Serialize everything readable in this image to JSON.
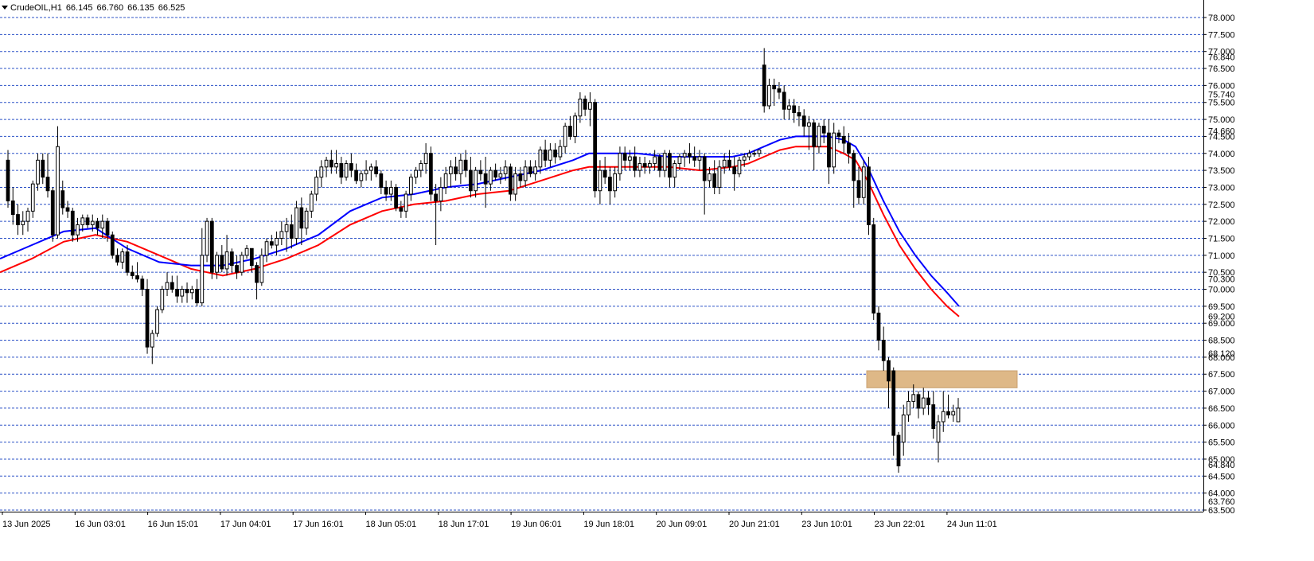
{
  "header": {
    "symbol_tf": "CrudeOIL,H1",
    "open": "66.145",
    "high": "66.760",
    "low": "66.135",
    "close": "66.525"
  },
  "colors": {
    "grid": "#2f54c7",
    "bull": "#ffffff",
    "bear": "#000000",
    "ma_fast": "#0000ff",
    "ma_slow": "#ff0000",
    "zone": "#deb887",
    "border": "#000000"
  },
  "chart_data": {
    "type": "candlestick",
    "symbol": "CrudeOIL",
    "timeframe": "H1",
    "ylim": [
      63.5,
      78.0
    ],
    "y_ticks": [
      "78.000",
      "77.500",
      "77.000",
      "76.500",
      "76.000",
      "75.500",
      "75.000",
      "74.500",
      "74.000",
      "73.500",
      "73.000",
      "72.500",
      "72.000",
      "71.500",
      "71.000",
      "70.500",
      "70.000",
      "69.500",
      "69.000",
      "68.500",
      "68.000",
      "67.500",
      "67.000",
      "66.500",
      "66.000",
      "65.500",
      "65.000",
      "64.500",
      "64.000",
      "63.500"
    ],
    "partial_labels": [
      "76.840",
      "75.740",
      "74.660",
      "70.300",
      "69.200",
      "68.120",
      "64.840",
      "63.760"
    ],
    "x_labels": [
      "13 Jun 2025",
      "16 Jun 03:01",
      "16 Jun 15:01",
      "17 Jun 04:01",
      "17 Jun 16:01",
      "18 Jun 05:01",
      "18 Jun 17:01",
      "19 Jun 06:01",
      "19 Jun 18:01",
      "20 Jun 09:01",
      "20 Jun 21:01",
      "23 Jun 10:01",
      "23 Jun 22:01",
      "24 Jun 11:01"
    ],
    "ohlc": [
      [
        73.8,
        74.1,
        72.4,
        72.6
      ],
      [
        72.6,
        73.0,
        71.9,
        72.2
      ],
      [
        72.2,
        72.5,
        71.6,
        71.9
      ],
      [
        71.9,
        72.3,
        71.6,
        72.0
      ],
      [
        72.0,
        72.4,
        71.7,
        72.3
      ],
      [
        72.3,
        73.2,
        72.1,
        73.1
      ],
      [
        73.1,
        74.0,
        72.9,
        73.8
      ],
      [
        73.8,
        74.0,
        73.1,
        73.3
      ],
      [
        73.3,
        74.0,
        72.7,
        72.9
      ],
      [
        72.9,
        73.0,
        71.4,
        71.6
      ],
      [
        71.6,
        74.8,
        71.5,
        74.2
      ],
      [
        72.9,
        73.2,
        72.2,
        72.4
      ],
      [
        72.4,
        72.6,
        72.1,
        72.3
      ],
      [
        72.3,
        72.4,
        71.4,
        71.6
      ],
      [
        71.6,
        72.1,
        71.4,
        71.9
      ],
      [
        71.9,
        72.2,
        71.7,
        72.1
      ],
      [
        72.1,
        72.2,
        71.8,
        71.9
      ],
      [
        71.9,
        72.2,
        71.7,
        72.0
      ],
      [
        72.0,
        72.1,
        71.6,
        71.8
      ],
      [
        71.8,
        72.2,
        71.5,
        72.0
      ],
      [
        72.0,
        72.1,
        71.4,
        71.6
      ],
      [
        71.6,
        71.7,
        70.9,
        71.0
      ],
      [
        71.0,
        71.2,
        70.7,
        70.8
      ],
      [
        70.8,
        71.2,
        70.6,
        71.1
      ],
      [
        71.1,
        71.3,
        70.4,
        70.5
      ],
      [
        70.5,
        70.7,
        70.3,
        70.4
      ],
      [
        70.4,
        70.8,
        70.2,
        70.3
      ],
      [
        70.3,
        70.4,
        69.8,
        70.0
      ],
      [
        70.0,
        70.3,
        68.1,
        68.3
      ],
      [
        68.3,
        68.8,
        67.8,
        68.7
      ],
      [
        68.7,
        69.5,
        68.6,
        69.4
      ],
      [
        69.4,
        70.1,
        69.3,
        70.0
      ],
      [
        70.0,
        70.5,
        69.8,
        70.2
      ],
      [
        70.2,
        70.4,
        69.9,
        70.0
      ],
      [
        70.0,
        70.4,
        69.6,
        69.8
      ],
      [
        69.8,
        70.1,
        69.6,
        70.0
      ],
      [
        70.0,
        70.2,
        69.6,
        69.9
      ],
      [
        69.9,
        70.1,
        69.7,
        70.0
      ],
      [
        70.0,
        70.3,
        69.5,
        69.6
      ],
      [
        69.6,
        71.8,
        69.5,
        71.0
      ],
      [
        71.0,
        72.1,
        70.8,
        72.0
      ],
      [
        72.0,
        72.1,
        70.3,
        70.5
      ],
      [
        70.5,
        71.1,
        70.3,
        71.0
      ],
      [
        71.0,
        71.3,
        70.5,
        70.6
      ],
      [
        70.6,
        71.6,
        70.4,
        71.1
      ],
      [
        71.1,
        71.2,
        70.5,
        70.7
      ],
      [
        70.7,
        71.0,
        70.3,
        70.5
      ],
      [
        70.5,
        71.1,
        70.4,
        71.0
      ],
      [
        71.0,
        71.3,
        70.9,
        71.2
      ],
      [
        71.2,
        71.0,
        70.5,
        70.7
      ],
      [
        70.7,
        70.8,
        69.7,
        70.2
      ],
      [
        70.2,
        71.2,
        70.1,
        71.0
      ],
      [
        71.0,
        71.5,
        70.8,
        71.4
      ],
      [
        71.4,
        71.6,
        71.2,
        71.3
      ],
      [
        71.3,
        71.7,
        71.0,
        71.5
      ],
      [
        71.5,
        72.0,
        71.3,
        71.7
      ],
      [
        71.7,
        72.1,
        71.1,
        71.9
      ],
      [
        71.9,
        72.2,
        71.2,
        71.5
      ],
      [
        71.5,
        72.6,
        71.3,
        72.4
      ],
      [
        72.4,
        72.7,
        71.3,
        71.8
      ],
      [
        71.8,
        72.4,
        71.6,
        72.3
      ],
      [
        72.3,
        72.9,
        72.1,
        72.8
      ],
      [
        72.8,
        73.5,
        72.6,
        73.3
      ],
      [
        73.3,
        73.8,
        73.0,
        73.6
      ],
      [
        73.6,
        73.9,
        73.3,
        73.8
      ],
      [
        73.8,
        74.1,
        73.4,
        73.6
      ],
      [
        73.6,
        74.1,
        73.4,
        73.7
      ],
      [
        73.7,
        73.9,
        73.1,
        73.3
      ],
      [
        73.3,
        73.8,
        73.2,
        73.7
      ],
      [
        73.7,
        74.0,
        73.3,
        73.5
      ],
      [
        73.5,
        73.7,
        73.1,
        73.2
      ],
      [
        73.2,
        73.5,
        73.0,
        73.4
      ],
      [
        73.4,
        73.8,
        73.2,
        73.5
      ],
      [
        73.5,
        73.7,
        73.2,
        73.6
      ],
      [
        73.6,
        73.8,
        73.3,
        73.4
      ],
      [
        73.4,
        73.5,
        72.8,
        73.0
      ],
      [
        73.0,
        73.2,
        72.6,
        72.8
      ],
      [
        72.8,
        73.2,
        72.6,
        73.0
      ],
      [
        73.0,
        73.1,
        72.3,
        72.4
      ],
      [
        72.4,
        72.6,
        72.1,
        72.3
      ],
      [
        72.3,
        72.9,
        72.1,
        72.8
      ],
      [
        72.8,
        73.4,
        72.6,
        73.3
      ],
      [
        73.3,
        73.6,
        73.1,
        73.5
      ],
      [
        73.5,
        73.8,
        73.3,
        73.7
      ],
      [
        73.7,
        74.3,
        73.4,
        74.0
      ],
      [
        74.0,
        74.2,
        72.6,
        72.8
      ],
      [
        72.8,
        73.1,
        71.3,
        72.6
      ],
      [
        72.6,
        73.3,
        72.3,
        73.0
      ],
      [
        73.0,
        73.6,
        72.8,
        73.4
      ],
      [
        73.4,
        73.8,
        73.0,
        73.6
      ],
      [
        73.6,
        73.9,
        73.2,
        73.4
      ],
      [
        73.4,
        74.0,
        73.1,
        73.8
      ],
      [
        73.8,
        74.1,
        73.3,
        73.5
      ],
      [
        73.5,
        73.9,
        72.7,
        72.9
      ],
      [
        72.9,
        73.6,
        72.7,
        73.5
      ],
      [
        73.5,
        73.8,
        73.2,
        73.4
      ],
      [
        73.4,
        73.9,
        72.4,
        73.1
      ],
      [
        73.1,
        73.6,
        72.9,
        73.5
      ],
      [
        73.5,
        73.7,
        73.2,
        73.3
      ],
      [
        73.3,
        73.6,
        73.1,
        73.4
      ],
      [
        73.4,
        73.8,
        73.2,
        73.6
      ],
      [
        73.6,
        73.7,
        72.6,
        72.8
      ],
      [
        72.8,
        73.6,
        72.6,
        73.4
      ],
      [
        73.4,
        73.6,
        73.0,
        73.2
      ],
      [
        73.2,
        73.8,
        73.0,
        73.6
      ],
      [
        73.6,
        73.8,
        73.3,
        73.4
      ],
      [
        73.4,
        73.8,
        73.2,
        73.6
      ],
      [
        73.6,
        74.2,
        73.4,
        74.1
      ],
      [
        74.1,
        74.4,
        73.6,
        73.8
      ],
      [
        73.8,
        74.3,
        73.6,
        74.1
      ],
      [
        74.1,
        74.3,
        73.7,
        73.9
      ],
      [
        73.9,
        74.4,
        73.8,
        74.2
      ],
      [
        74.2,
        74.9,
        74.0,
        74.8
      ],
      [
        74.8,
        75.1,
        74.4,
        74.5
      ],
      [
        74.5,
        75.2,
        74.3,
        75.1
      ],
      [
        75.1,
        75.8,
        74.9,
        75.6
      ],
      [
        75.6,
        75.7,
        75.1,
        75.3
      ],
      [
        75.3,
        75.8,
        74.8,
        75.5
      ],
      [
        75.5,
        75.6,
        72.7,
        72.9
      ],
      [
        72.9,
        73.8,
        72.5,
        73.5
      ],
      [
        73.5,
        73.9,
        73.1,
        73.3
      ],
      [
        73.3,
        73.6,
        72.5,
        72.9
      ],
      [
        72.9,
        73.6,
        72.7,
        73.4
      ],
      [
        73.4,
        74.2,
        73.2,
        74.0
      ],
      [
        74.0,
        74.2,
        73.5,
        73.8
      ],
      [
        73.8,
        74.1,
        73.5,
        73.9
      ],
      [
        73.9,
        74.2,
        73.3,
        73.5
      ],
      [
        73.5,
        73.9,
        73.3,
        73.7
      ],
      [
        73.7,
        73.9,
        73.4,
        73.6
      ],
      [
        73.6,
        73.8,
        73.4,
        73.7
      ],
      [
        73.7,
        74.1,
        73.5,
        73.9
      ],
      [
        73.9,
        74.0,
        73.3,
        73.5
      ],
      [
        73.5,
        74.1,
        73.3,
        74.0
      ],
      [
        74.0,
        74.1,
        73.0,
        73.3
      ],
      [
        73.3,
        73.8,
        73.0,
        73.7
      ],
      [
        73.7,
        74.0,
        73.5,
        73.9
      ],
      [
        73.9,
        74.1,
        73.6,
        74.0
      ],
      [
        74.0,
        74.3,
        73.7,
        73.9
      ],
      [
        73.9,
        74.2,
        73.6,
        73.8
      ],
      [
        73.8,
        74.1,
        73.5,
        73.9
      ],
      [
        73.9,
        74.0,
        72.2,
        73.2
      ],
      [
        73.2,
        73.6,
        73.0,
        73.4
      ],
      [
        73.4,
        73.8,
        72.8,
        73.0
      ],
      [
        73.0,
        73.8,
        72.8,
        73.6
      ],
      [
        73.6,
        74.0,
        73.4,
        73.8
      ],
      [
        73.8,
        74.1,
        73.5,
        73.6
      ],
      [
        73.6,
        73.9,
        72.9,
        73.4
      ],
      [
        73.4,
        73.9,
        73.3,
        73.8
      ],
      [
        73.8,
        74.0,
        73.6,
        73.9
      ],
      [
        73.9,
        74.1,
        73.8,
        74.0
      ],
      [
        74.0,
        74.1,
        73.9,
        74.0
      ],
      [
        74.0,
        74.1,
        73.9,
        74.1
      ],
      [
        76.6,
        77.1,
        75.2,
        75.4
      ],
      [
        75.4,
        76.2,
        75.3,
        76.0
      ],
      [
        76.0,
        76.2,
        75.4,
        75.9
      ],
      [
        75.9,
        76.1,
        75.6,
        75.8
      ],
      [
        75.8,
        76.0,
        75.0,
        75.3
      ],
      [
        75.3,
        75.6,
        75.0,
        75.4
      ],
      [
        75.4,
        75.6,
        74.9,
        75.2
      ],
      [
        75.2,
        75.4,
        74.8,
        75.1
      ],
      [
        75.1,
        75.3,
        74.5,
        74.8
      ],
      [
        74.8,
        75.1,
        74.1,
        74.9
      ],
      [
        74.9,
        75.0,
        73.5,
        74.2
      ],
      [
        74.2,
        74.9,
        74.0,
        74.8
      ],
      [
        74.8,
        75.0,
        74.3,
        74.6
      ],
      [
        74.6,
        75.0,
        73.1,
        73.6
      ],
      [
        73.6,
        74.9,
        73.4,
        74.6
      ],
      [
        74.6,
        74.7,
        74.3,
        74.5
      ],
      [
        74.5,
        74.8,
        74.0,
        74.3
      ],
      [
        74.3,
        74.6,
        73.7,
        74.0
      ],
      [
        74.0,
        74.1,
        72.4,
        73.2
      ],
      [
        73.2,
        73.6,
        72.5,
        72.7
      ],
      [
        72.7,
        73.8,
        72.5,
        73.6
      ],
      [
        73.6,
        73.9,
        71.6,
        71.9
      ],
      [
        71.9,
        72.1,
        69.1,
        69.3
      ],
      [
        69.3,
        69.5,
        68.2,
        68.5
      ],
      [
        68.5,
        68.9,
        67.6,
        67.9
      ],
      [
        67.9,
        68.0,
        66.5,
        67.3
      ],
      [
        67.6,
        67.7,
        65.1,
        65.7
      ],
      [
        65.7,
        65.8,
        64.6,
        64.8
      ],
      [
        65.5,
        66.6,
        65.1,
        66.3
      ],
      [
        66.3,
        67.0,
        66.1,
        66.7
      ],
      [
        66.7,
        67.2,
        66.5,
        66.9
      ],
      [
        66.9,
        67.0,
        66.2,
        66.5
      ],
      [
        66.5,
        67.1,
        66.3,
        66.8
      ],
      [
        66.8,
        67.0,
        66.3,
        66.6
      ],
      [
        66.6,
        67.0,
        65.6,
        65.9
      ],
      [
        65.5,
        66.3,
        64.9,
        66.1
      ],
      [
        66.1,
        67.0,
        65.8,
        66.4
      ],
      [
        66.4,
        66.9,
        66.2,
        66.3
      ],
      [
        66.3,
        66.6,
        66.1,
        66.4
      ],
      [
        66.1,
        66.8,
        66.1,
        66.5
      ]
    ],
    "ma_fast": [
      [
        0,
        70.9
      ],
      [
        40,
        71.3
      ],
      [
        80,
        71.7
      ],
      [
        120,
        71.8
      ],
      [
        160,
        71.2
      ],
      [
        200,
        70.8
      ],
      [
        240,
        70.7
      ],
      [
        280,
        70.7
      ],
      [
        320,
        70.9
      ],
      [
        360,
        71.2
      ],
      [
        400,
        71.6
      ],
      [
        440,
        72.3
      ],
      [
        480,
        72.7
      ],
      [
        520,
        72.8
      ],
      [
        560,
        73.0
      ],
      [
        600,
        73.1
      ],
      [
        640,
        73.3
      ],
      [
        680,
        73.5
      ],
      [
        720,
        73.8
      ],
      [
        740,
        74.0
      ],
      [
        760,
        74.0
      ],
      [
        800,
        74.0
      ],
      [
        840,
        73.9
      ],
      [
        880,
        73.9
      ],
      [
        920,
        73.9
      ],
      [
        940,
        74.0
      ],
      [
        960,
        74.2
      ],
      [
        980,
        74.4
      ],
      [
        1000,
        74.5
      ],
      [
        1020,
        74.5
      ],
      [
        1040,
        74.5
      ],
      [
        1060,
        74.4
      ],
      [
        1075,
        74.2
      ],
      [
        1090,
        73.6
      ],
      [
        1110,
        72.6
      ],
      [
        1130,
        71.7
      ],
      [
        1150,
        71.0
      ],
      [
        1170,
        70.4
      ],
      [
        1190,
        69.9
      ],
      [
        1205,
        69.5
      ]
    ],
    "ma_slow": [
      [
        0,
        70.5
      ],
      [
        40,
        70.9
      ],
      [
        80,
        71.4
      ],
      [
        120,
        71.6
      ],
      [
        160,
        71.4
      ],
      [
        200,
        71.0
      ],
      [
        240,
        70.6
      ],
      [
        280,
        70.4
      ],
      [
        320,
        70.6
      ],
      [
        360,
        70.9
      ],
      [
        400,
        71.3
      ],
      [
        440,
        71.9
      ],
      [
        480,
        72.3
      ],
      [
        520,
        72.5
      ],
      [
        560,
        72.6
      ],
      [
        600,
        72.8
      ],
      [
        640,
        72.9
      ],
      [
        680,
        73.2
      ],
      [
        720,
        73.5
      ],
      [
        740,
        73.6
      ],
      [
        760,
        73.6
      ],
      [
        800,
        73.6
      ],
      [
        840,
        73.6
      ],
      [
        880,
        73.5
      ],
      [
        920,
        73.6
      ],
      [
        940,
        73.7
      ],
      [
        960,
        73.9
      ],
      [
        980,
        74.1
      ],
      [
        1000,
        74.2
      ],
      [
        1020,
        74.2
      ],
      [
        1040,
        74.2
      ],
      [
        1060,
        74.0
      ],
      [
        1075,
        73.8
      ],
      [
        1090,
        73.2
      ],
      [
        1110,
        72.2
      ],
      [
        1130,
        71.3
      ],
      [
        1150,
        70.6
      ],
      [
        1170,
        70.0
      ],
      [
        1190,
        69.5
      ],
      [
        1205,
        69.2
      ]
    ],
    "zone": {
      "from": 67.1,
      "to": 67.6
    },
    "grid": true
  }
}
